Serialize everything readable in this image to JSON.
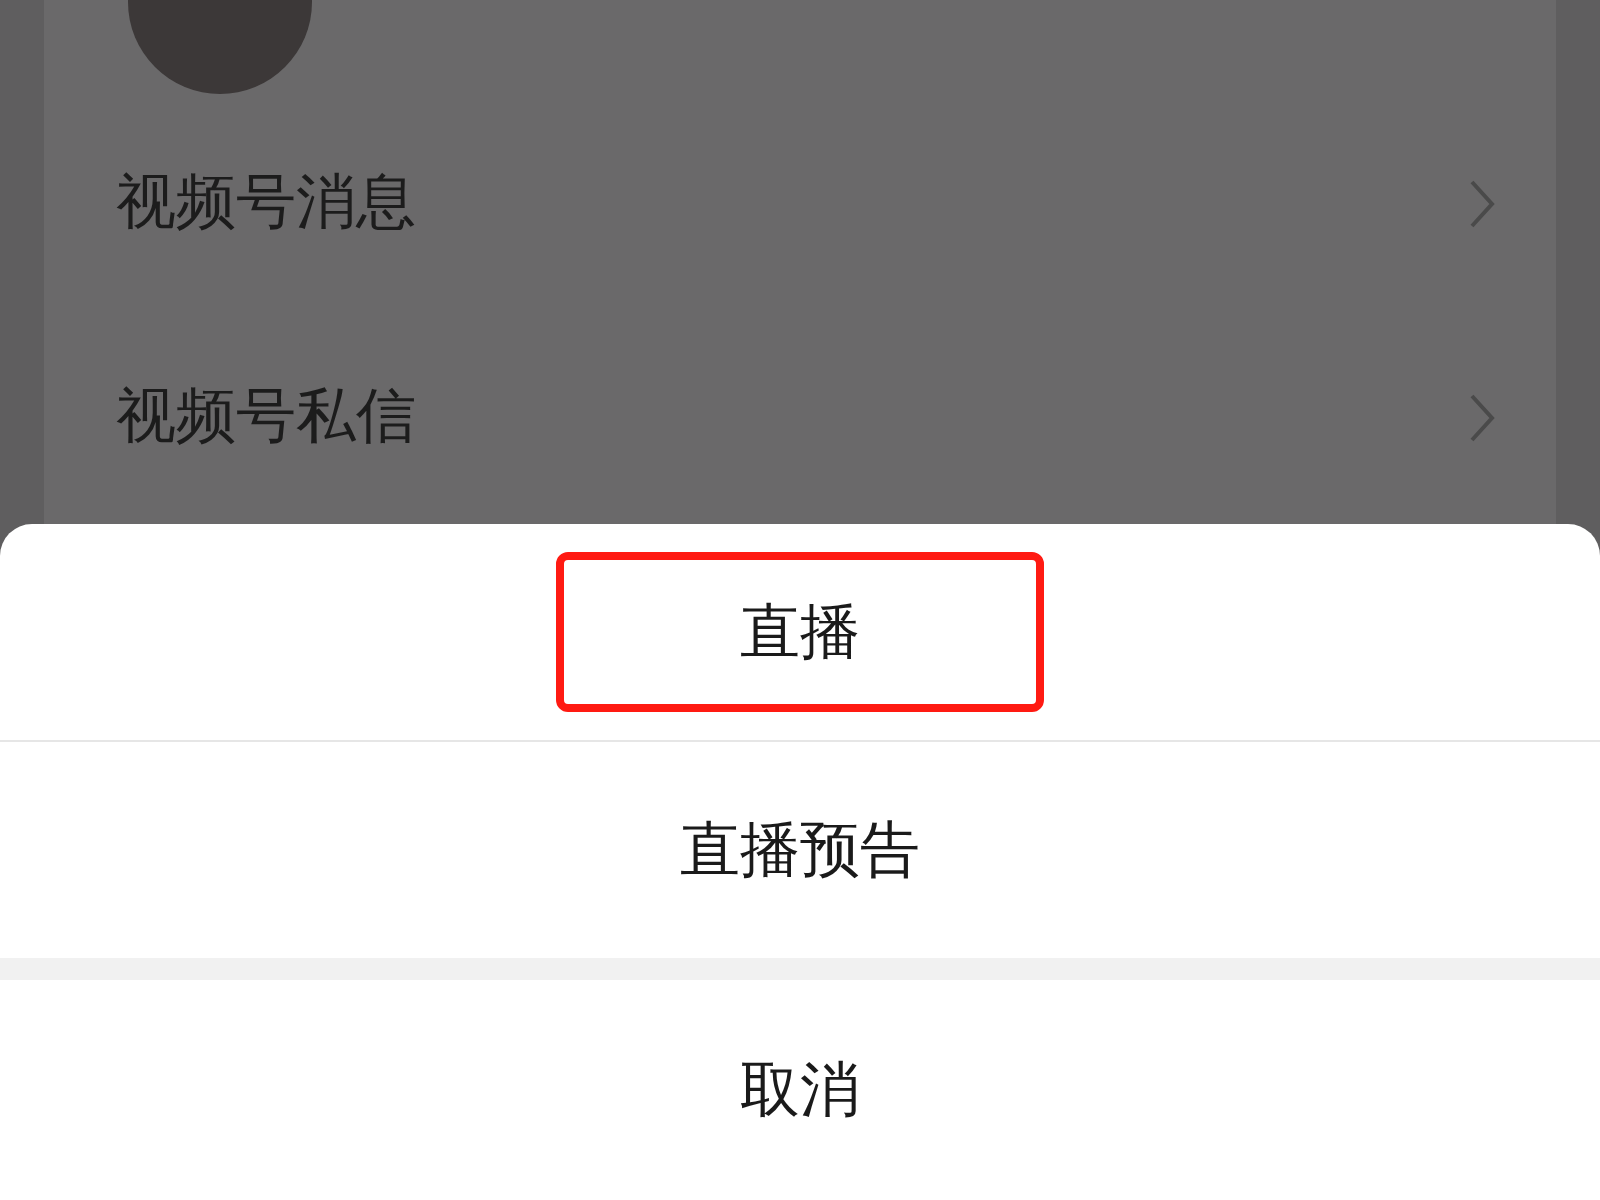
{
  "list": {
    "items": [
      {
        "label": "视频号消息"
      },
      {
        "label": "视频号私信"
      }
    ]
  },
  "action_sheet": {
    "actions": [
      {
        "label": "直播",
        "highlighted": true
      },
      {
        "label": "直播预告",
        "highlighted": false
      }
    ],
    "cancel": "取消"
  }
}
